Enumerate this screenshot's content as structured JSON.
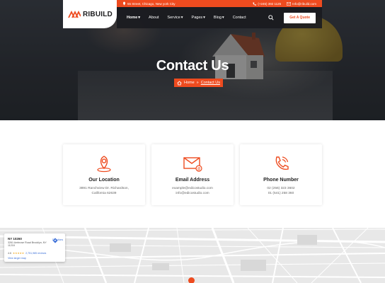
{
  "brand": {
    "name": "RIBUILD",
    "accent": "#ee4b1f"
  },
  "topbar": {
    "address": "55 Street, Chicago, New york City",
    "phone": "(+245) 392 1125",
    "email": "Info@ribuild.com"
  },
  "nav": {
    "items": [
      {
        "label": "Home",
        "dropdown": true,
        "active": true
      },
      {
        "label": "About",
        "dropdown": false
      },
      {
        "label": "Service",
        "dropdown": true
      },
      {
        "label": "Pages",
        "dropdown": true
      },
      {
        "label": "Blog",
        "dropdown": true
      },
      {
        "label": "Contact",
        "dropdown": false
      }
    ],
    "cta_label": "Get A Quote",
    "search_icon": "search-icon"
  },
  "hero": {
    "title": "Contact Us",
    "breadcrumb": {
      "home": "Home",
      "separator": "»",
      "current": "Contact Us"
    }
  },
  "cards": [
    {
      "icon": "location-pin-icon",
      "title": "Our Location",
      "lines": [
        "3891 Ranchview Dr. Richardson,",
        "California 62639"
      ]
    },
    {
      "icon": "email-icon",
      "title": "Email Address",
      "lines": [
        "example@edicostudio.com",
        "info@edicostudio.com"
      ]
    },
    {
      "icon": "phone-icon",
      "title": "Phone Number",
      "lines": [
        "02 (256) 323 3602",
        "01 (541) 258 360"
      ]
    }
  ],
  "map": {
    "place_title": "NY 10260",
    "place_address": "3261 Ambrose Road Brooklyn, NY 11218",
    "rating": "4.6",
    "stars": "★★★★★",
    "reviews": "2,751,985 reviews",
    "view_link": "View larger map",
    "directions": "Directions"
  }
}
